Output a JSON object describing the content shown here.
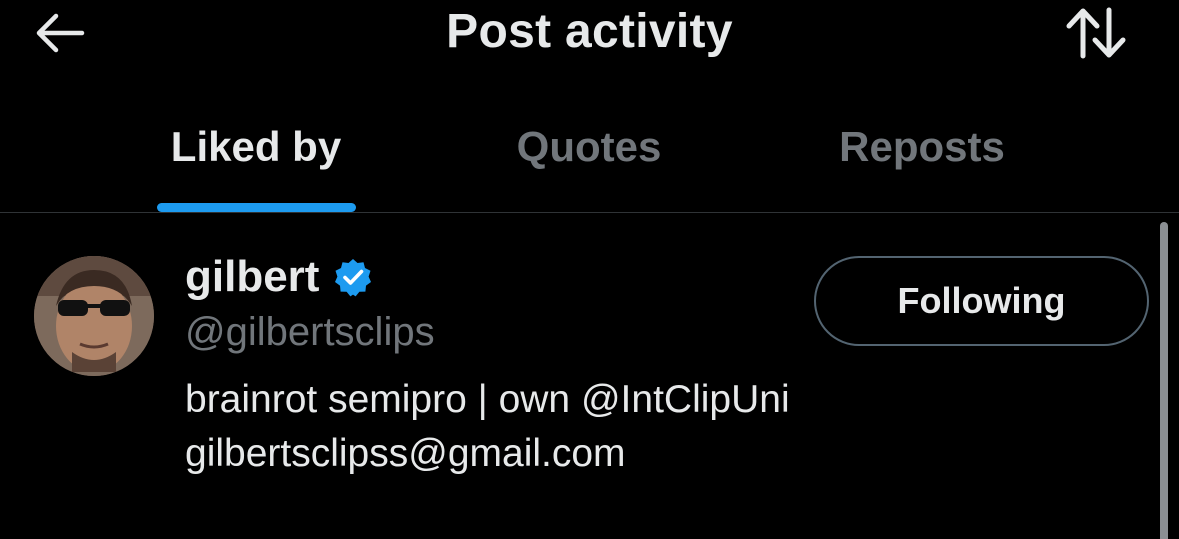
{
  "header": {
    "title": "Post activity",
    "back_icon": "arrow-left-icon",
    "sort_icon": "sort-arrows-icon"
  },
  "tabs": [
    {
      "label": "Liked by",
      "active": true
    },
    {
      "label": "Quotes",
      "active": false
    },
    {
      "label": "Reposts",
      "active": false
    }
  ],
  "colors": {
    "background": "#000000",
    "accent": "#1d9bf0",
    "primary_text": "#e7e9ea",
    "secondary_text": "#71767b",
    "divider": "#2f3336"
  },
  "users": [
    {
      "display_name": "gilbert",
      "verified": true,
      "handle": "@gilbertsclips",
      "bio_lines": [
        "brainrot semipro | own @IntClipUni",
        "gilbertsclipss@gmail.com"
      ],
      "follow_button_label": "Following"
    }
  ]
}
